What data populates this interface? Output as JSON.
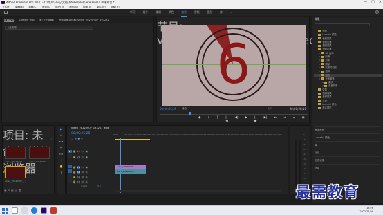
{
  "window": {
    "title": "Adobe Premiere Pro 2020 - C:\\用户\\Ebuy\\文档\\Adobe\\Premiere Pro\\14.0\\未命名 *",
    "controls": [
      "—",
      "□",
      "✕"
    ]
  },
  "menu": [
    "文件(F)",
    "编辑(E)",
    "剪辑(C)",
    "序列(S)",
    "标记(M)",
    "图形(G)",
    "视图(V)",
    "窗口(W)",
    "帮助(H)"
  ],
  "workspaces": {
    "tabs": [
      "学习",
      "组件",
      "编辑",
      "颜色",
      "效果",
      "音频",
      "图形",
      "库"
    ],
    "active": "效果",
    "more": "»"
  },
  "source_panel": {
    "tabs": [
      "效果控件",
      "Lumetri 范围",
      "源：(无剪辑)",
      "音频剪辑混合器: video_20220907_193251"
    ],
    "dropdown": "（无剪辑）"
  },
  "program_monitor": {
    "title": "节目: video_20220907_193251_edit",
    "countdown_number": "6",
    "timecode": "00;00;05;25",
    "fit": "适合",
    "quality": "1/2",
    "duration": "00;00;28;18",
    "transport": [
      "◆",
      "{",
      "}",
      "|◀",
      "◀|",
      "▶",
      "|▶",
      "▶|",
      "⇤",
      "⇥",
      "⌗",
      "◉",
      "+"
    ]
  },
  "effects_panel": {
    "title": "效果",
    "items": [
      {
        "label": "预设",
        "indent": 1
      },
      {
        "label": "Lumetri 预设",
        "indent": 1
      },
      {
        "label": "音频效果",
        "indent": 1
      },
      {
        "label": "音频过渡",
        "indent": 1
      },
      {
        "label": "视频效果",
        "indent": 1
      },
      {
        "label": "视频过渡",
        "indent": 1
      },
      {
        "label": "3D 运动",
        "indent": 2
      },
      {
        "label": "内滑",
        "indent": 2
      },
      {
        "label": "划像",
        "indent": 2
      },
      {
        "label": "擦除",
        "indent": 2
      },
      {
        "label": "沉浸式视频",
        "indent": 2
      },
      {
        "label": "溶解",
        "indent": 2
      },
      {
        "label": "缩放",
        "indent": 2,
        "selected": true
      },
      {
        "label": "页面剥落",
        "indent": 2
      },
      {
        "label": "翻页",
        "indent": 3
      },
      {
        "label": "页面剥落",
        "indent": 3
      },
      {
        "label": "效果",
        "indent": 1
      },
      {
        "label": "视频效果",
        "indent": 1
      },
      {
        "label": "音频效果",
        "indent": 1
      },
      {
        "label": "过渡",
        "indent": 1
      },
      {
        "label": "Lumetri 颜色",
        "indent": 1
      },
      {
        "label": "基本图形",
        "indent": 1
      }
    ],
    "sections": [
      "基本声音",
      "Lumetri 颜色",
      "库",
      "标记",
      "历史记录",
      "信息"
    ]
  },
  "project_panel": {
    "tabs": [
      "项目: 未命名",
      "媒体浏览器"
    ],
    "path": "未命名.prproj",
    "items": [
      {
        "label": "video_20220907...",
        "selected": false
      },
      {
        "label": "video_20220907...",
        "selected": false
      },
      {
        "label": "video_20220907_...",
        "selected": true
      }
    ]
  },
  "timeline": {
    "title": "video_20220907_193251_edit",
    "timecode": "00;00;05;25",
    "ruler": [
      "00;00",
      "00;00;04;00",
      "00;00;08;00",
      "00;00;12;00",
      "00;00;16;00",
      "00;00;20;00",
      "00;00;24;00",
      "00;00;28;00",
      "00;00;32;00",
      "00;00;36;00",
      "00;00;40;00",
      "00;00;44;00",
      "00;00;48;00",
      "00;00;52;00"
    ],
    "tracks": [
      "V3",
      "V2",
      "V1",
      "A1",
      "A2",
      "A3",
      "主声道"
    ],
    "master_value": "0.0",
    "clip_video": "video_20220907...",
    "clip_audio": "video_20220907...",
    "meter_scale": [
      "0",
      "-6",
      "-12",
      "-18",
      "-24",
      "-30",
      "-36",
      "-42",
      "-48",
      "-54"
    ],
    "meter_labels": [
      "S",
      "S"
    ]
  },
  "taskbar": {
    "time": "15:26",
    "date": "2022/11/28"
  },
  "watermark": "最需教育",
  "colors": {
    "accent": "#4d8fe0",
    "clip_video": "#a978c5",
    "clip_audio": "#4e8f9e",
    "countdown_bg": "#b9a6a6"
  }
}
